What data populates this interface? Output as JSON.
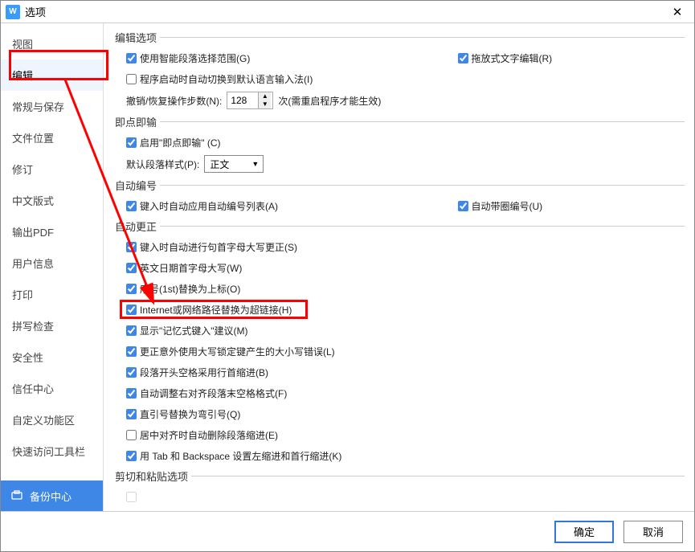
{
  "window": {
    "title": "选项"
  },
  "sidebar": {
    "items": [
      "视图",
      "编辑",
      "常规与保存",
      "文件位置",
      "修订",
      "中文版式",
      "输出PDF",
      "用户信息",
      "打印",
      "拼写检查",
      "安全性",
      "信任中心",
      "自定义功能区",
      "快速访问工具栏"
    ],
    "selected_index": 1,
    "backup_label": "备份中心"
  },
  "groups": {
    "edit_options": {
      "title": "编辑选项",
      "smart_paragraph": "使用智能段落选择范围(G)",
      "drag_edit": "拖放式文字编辑(R)",
      "auto_switch_ime": "程序启动时自动切换到默认语言输入法(I)",
      "undo_label": "撤销/恢复操作步数(N):",
      "undo_value": "128",
      "undo_suffix": "次(需重启程序才能生效)"
    },
    "click_type": {
      "title": "即点即输",
      "enable": "启用\"即点即输\" (C)",
      "default_style_label": "默认段落样式(P):",
      "default_style_value": "正文"
    },
    "auto_number": {
      "title": "自动编号",
      "apply_list": "键入时自动应用自动编号列表(A)",
      "auto_circle": "自动带圈编号(U)"
    },
    "auto_correct": {
      "title": "自动更正",
      "items": [
        "键入时自动进行句首字母大写更正(S)",
        "英文日期首字母大写(W)",
        "序号(1st)替换为上标(O)",
        "Internet或网络路径替换为超链接(H)",
        "显示\"记忆式键入\"建议(M)",
        "更正意外使用大写锁定键产生的大小写错误(L)",
        "段落开头空格采用行首缩进(B)",
        "自动调整右对齐段落末空格格式(F)",
        "直引号替换为弯引号(Q)",
        "居中对齐时自动删除段落缩进(E)",
        "用 Tab 和 Backspace 设置左缩进和首行缩进(K)"
      ],
      "unchecked": [
        9
      ]
    },
    "clip_paste": {
      "title": "剪切和粘贴选项"
    }
  },
  "footer": {
    "ok": "确定",
    "cancel": "取消"
  }
}
